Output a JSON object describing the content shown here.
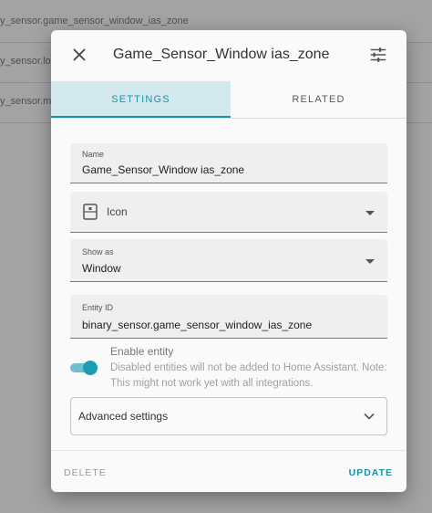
{
  "background": {
    "rows": [
      "y_sensor.game_sensor_window_ias_zone",
      "y_sensor.lo",
      "y_sensor.mb"
    ]
  },
  "dialog": {
    "title": "Game_Sensor_Window ias_zone",
    "close_icon": "close-icon",
    "settings_icon": "tune-icon",
    "tabs": [
      {
        "label": "SETTINGS",
        "active": true
      },
      {
        "label": "RELATED",
        "active": false
      }
    ],
    "name_field": {
      "label": "Name",
      "value": "Game_Sensor_Window ias_zone"
    },
    "icon_field": {
      "icon": "sensor-window-icon",
      "placeholder": "Icon"
    },
    "show_as_field": {
      "label": "Show as",
      "value": "Window"
    },
    "entity_id_field": {
      "label": "Entity ID",
      "value": "binary_sensor.game_sensor_window_ias_zone"
    },
    "enable_entity": {
      "title": "Enable entity",
      "description": "Disabled entities will not be added to Home Assistant. Note: This might not work yet with all integrations.",
      "enabled": true
    },
    "advanced_settings": {
      "label": "Advanced settings"
    },
    "footer": {
      "delete_label": "DELETE",
      "update_label": "UPDATE"
    },
    "colors": {
      "accent": "#1d90a8",
      "tab_active_bg": "#d4e9ee"
    }
  }
}
